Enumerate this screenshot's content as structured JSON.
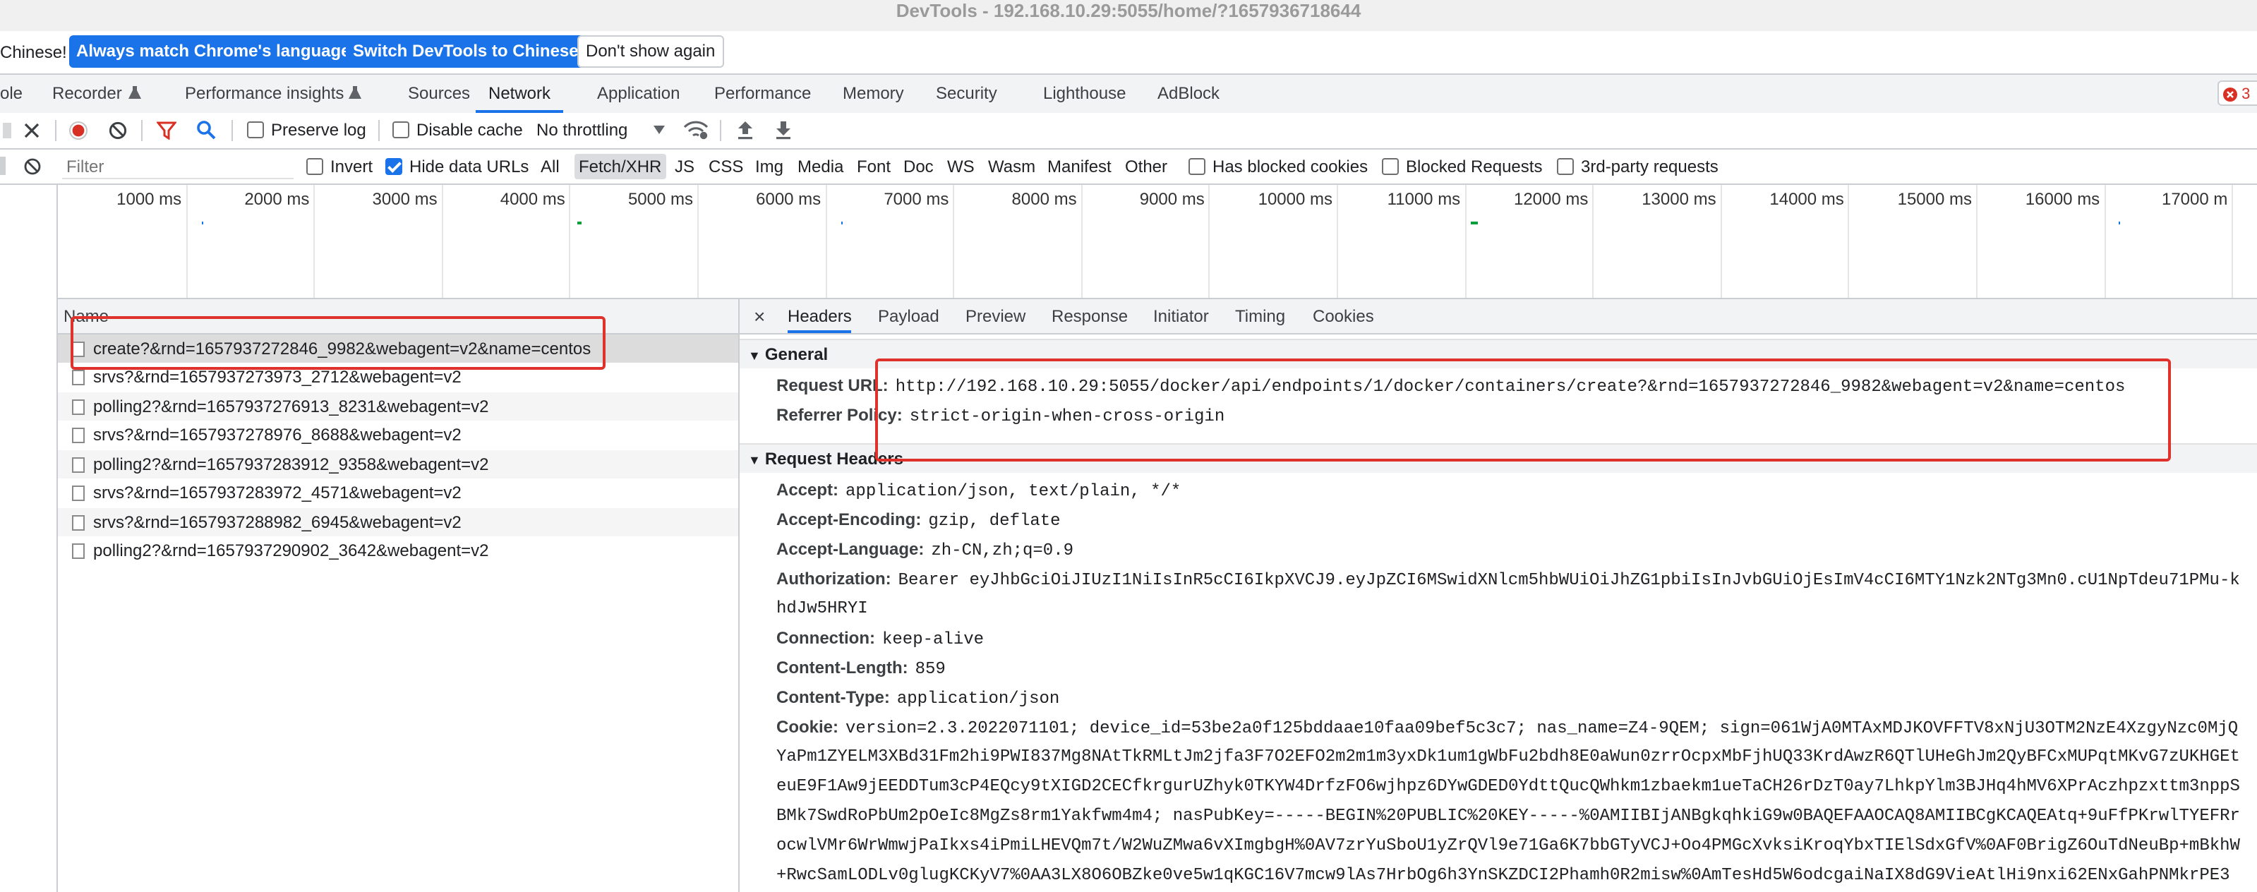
{
  "window": {
    "title": "DevTools - 192.168.10.29:5055/home/?1657936718644"
  },
  "infobar": {
    "message": "Chinese!",
    "match_language_label": "Always match Chrome's language",
    "switch_language_label": "Switch DevTools to Chinese",
    "dismiss_label": "Don't show again"
  },
  "panel_tabs": [
    {
      "label": "ole"
    },
    {
      "label": "Recorder"
    },
    {
      "label": "Performance insights"
    },
    {
      "label": "Sources"
    },
    {
      "label": "Network"
    },
    {
      "label": "Application"
    },
    {
      "label": "Performance"
    },
    {
      "label": "Memory"
    },
    {
      "label": "Security"
    },
    {
      "label": "Lighthouse"
    },
    {
      "label": "AdBlock"
    }
  ],
  "error_count": "3",
  "toolbar": {
    "preserve_log_label": "Preserve log",
    "preserve_log_checked": false,
    "disable_cache_label": "Disable cache",
    "disable_cache_checked": false,
    "throttling_value": "No throttling"
  },
  "filter": {
    "placeholder": "Filter",
    "invert_label": "Invert",
    "hide_data_urls_label": "Hide data URLs",
    "hide_data_urls_checked": true,
    "types": [
      "All",
      "Fetch/XHR",
      "JS",
      "CSS",
      "Img",
      "Media",
      "Font",
      "Doc",
      "WS",
      "Wasm",
      "Manifest",
      "Other"
    ],
    "active_type": "Fetch/XHR",
    "blocked_cookies_label": "Has blocked cookies",
    "blocked_requests_label": "Blocked Requests",
    "third_party_label": "3rd-party requests"
  },
  "timeline": {
    "ticks": [
      "1000 ms",
      "2000 ms",
      "3000 ms",
      "4000 ms",
      "5000 ms",
      "6000 ms",
      "7000 ms",
      "8000 ms",
      "9000 ms",
      "10000 ms",
      "11000 ms",
      "12000 ms",
      "13000 ms",
      "14000 ms",
      "15000 ms",
      "16000 ms",
      "17000 m"
    ]
  },
  "request_list": {
    "column_header": "Name",
    "rows": [
      "create?&rnd=1657937272846_9982&webagent=v2&name=centos",
      "srvs?&rnd=1657937273973_2712&webagent=v2",
      "polling2?&rnd=1657937276913_8231&webagent=v2",
      "srvs?&rnd=1657937278976_8688&webagent=v2",
      "polling2?&rnd=1657937283912_9358&webagent=v2",
      "srvs?&rnd=1657937283972_4571&webagent=v2",
      "srvs?&rnd=1657937288982_6945&webagent=v2",
      "polling2?&rnd=1657937290902_3642&webagent=v2"
    ],
    "selected_index": 0
  },
  "detail": {
    "close_glyph": "×",
    "tabs": [
      "Headers",
      "Payload",
      "Preview",
      "Response",
      "Initiator",
      "Timing",
      "Cookies"
    ],
    "active_tab": "Headers",
    "general": {
      "title": "General",
      "request_url_label": "Request URL:",
      "request_url_value": "http://192.168.10.29:5055/docker/api/endpoints/1/docker/containers/create?&rnd=1657937272846_9982&webagent=v2&name=centos",
      "referrer_policy_label": "Referrer Policy:",
      "referrer_policy_value": "strict-origin-when-cross-origin"
    },
    "request_headers": {
      "title": "Request Headers",
      "accept": {
        "name": "Accept:",
        "value": "application/json, text/plain, */*"
      },
      "accept_encoding": {
        "name": "Accept-Encoding:",
        "value": "gzip, deflate"
      },
      "accept_language": {
        "name": "Accept-Language:",
        "value": "zh-CN,zh;q=0.9"
      },
      "authorization": {
        "name": "Authorization:",
        "value": "Bearer eyJhbGciOiJIUzI1NiIsInR5cCI6IkpXVCJ9.eyJpZCI6MSwidXNlcm5hbWUiOiJhZG1pbiIsInJvbGUiOjEsImV4cCI6MTY1Nzk2NTg3Mn0.cU1NpTdeu71PMu-k",
        "continuation": "hdJw5HRYI"
      },
      "connection": {
        "name": "Connection:",
        "value": "keep-alive"
      },
      "content_length": {
        "name": "Content-Length:",
        "value": "859"
      },
      "content_type": {
        "name": "Content-Type:",
        "value": "application/json"
      },
      "cookie": {
        "name": "Cookie:",
        "value": "version=2.3.2022071101; device_id=53be2a0f125bddaae10faa09bef5c3c7; nas_name=Z4-9QEM; sign=061WjA0MTAxMDJKOVFFTV8xNjU3OTM2NzE4XzgyNzc0MjQ",
        "lines": [
          "YaPm1ZYELM3XBd31Fm2hi9PWI837Mg8NAtTkRMLtJm2jfa3F7O2EFO2m2m1m3yxDk1um1gWbFu2bdh8E0aWun0zrrOcpxMbFjhUQ33KrdAwzR6QTlUHeGhJm2QyBFCxMUPqtMKvG7zUKHGEt",
          "euE9F1Aw9jEEDDTum3cP4EQcy9tXIGD2CECfkrgurUZhyk0TKYW4DrfzFO6wjhpz6DYwGDED0YdttQucQWhkm1zbaekm1ueTaCH26rDzT0ay7LhkpYlm3BJHq4hMV6XPrAczhpzxttm3nppS",
          "BMk7SwdRoPbUm2pOeIc8MgZs8rm1Yakfwm4m4; nasPubKey=-----BEGIN%20PUBLIC%20KEY-----%0AMIIBIjANBgkqhkiG9w0BAQEFAAOCAQ8AMIIBCgKCAQEAtq+9uFfPKrwlTYEFRr",
          "ocwlVMr6WrWmwjPaIkxs4iPmiLHEVQm7t/W2WuZMwa6vXImgbgH%0AV7zrYuSboU1yZrQVl9e71Ga6K7bbGTyVCJ+Oo4PMGcXvksiKroqYbxTIElSdxGfV%0AF0BrigZ6OuTdNeuBp+mBkhW",
          "+RwcSamLODLv0glugKCKyV7%0AA3LX8O6OBZke0ve5w1qKGC16V7mcw9lAs7HrbOg6h3YnSKZDCI2Phamh0R2misw%0AmTesHd5W6odcgaiNaIX8dG9VieAtlHi9nxi62ENxGahPNMkrPE3"
        ]
      }
    }
  },
  "colors": {
    "accent": "#1a73e8",
    "highlight_box": "#e0322c",
    "record_red": "#d93025"
  }
}
